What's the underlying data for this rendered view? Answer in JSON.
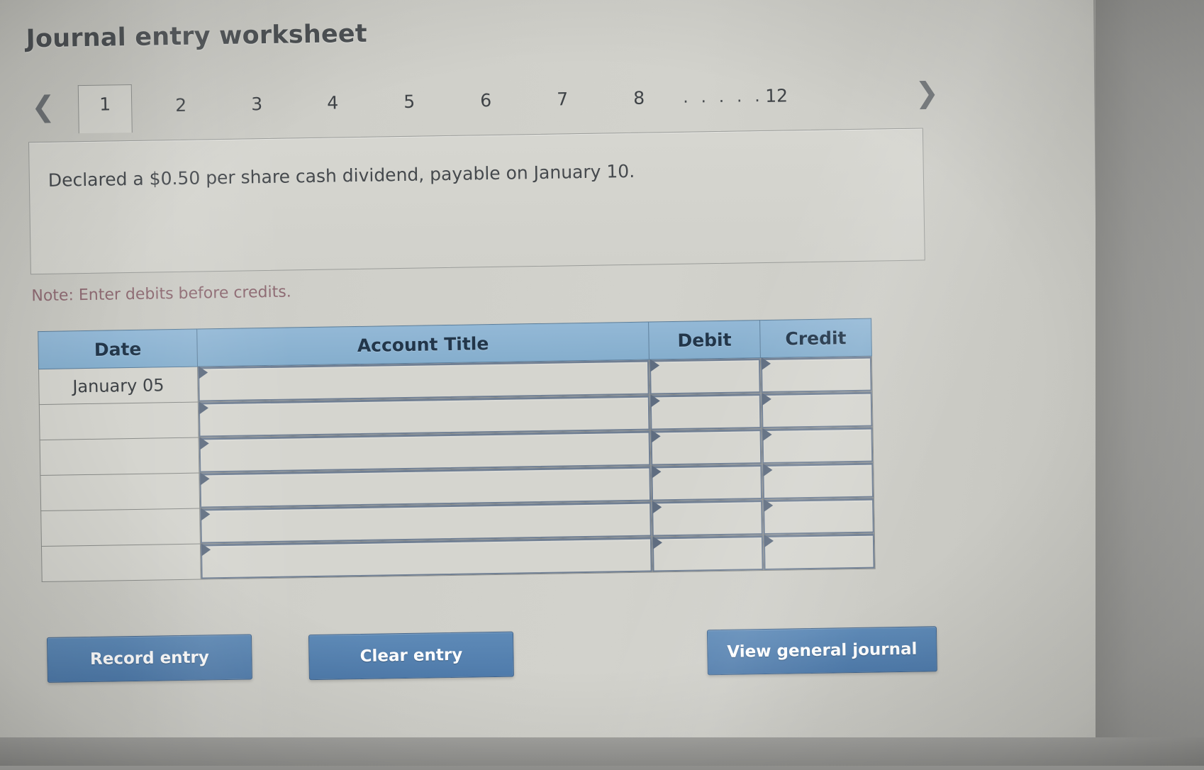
{
  "page": {
    "title": "Journal entry worksheet"
  },
  "tabs": {
    "prev_icon": "chevron-left-icon",
    "next_icon": "chevron-right-icon",
    "items": [
      {
        "label": "1",
        "active": true
      },
      {
        "label": "2",
        "active": false
      },
      {
        "label": "3",
        "active": false
      },
      {
        "label": "4",
        "active": false
      },
      {
        "label": "5",
        "active": false
      },
      {
        "label": "6",
        "active": false
      },
      {
        "label": "7",
        "active": false
      },
      {
        "label": "8",
        "active": false
      }
    ],
    "ellipsis": ". . . . .",
    "last": {
      "label": "12",
      "active": false
    }
  },
  "scenario": {
    "text": "Declared a $0.50 per share cash dividend, payable on January 10."
  },
  "note": {
    "text": "Note: Enter debits before credits."
  },
  "journal_table": {
    "headers": [
      "Date",
      "Account Title",
      "Debit",
      "Credit"
    ],
    "rows": [
      {
        "date": "January 05",
        "account_title": "",
        "debit": "",
        "credit": ""
      },
      {
        "date": "",
        "account_title": "",
        "debit": "",
        "credit": ""
      },
      {
        "date": "",
        "account_title": "",
        "debit": "",
        "credit": ""
      },
      {
        "date": "",
        "account_title": "",
        "debit": "",
        "credit": ""
      },
      {
        "date": "",
        "account_title": "",
        "debit": "",
        "credit": ""
      },
      {
        "date": "",
        "account_title": "",
        "debit": "",
        "credit": ""
      }
    ]
  },
  "buttons": {
    "record": "Record entry",
    "clear": "Clear entry",
    "view": "View general journal"
  },
  "colors": {
    "header_blue": "#8aafcd",
    "button_blue": "#5280ae",
    "note_red": "#8d6a72",
    "title_gray": "#4d5154",
    "page_bg": "#d2d2cc"
  }
}
